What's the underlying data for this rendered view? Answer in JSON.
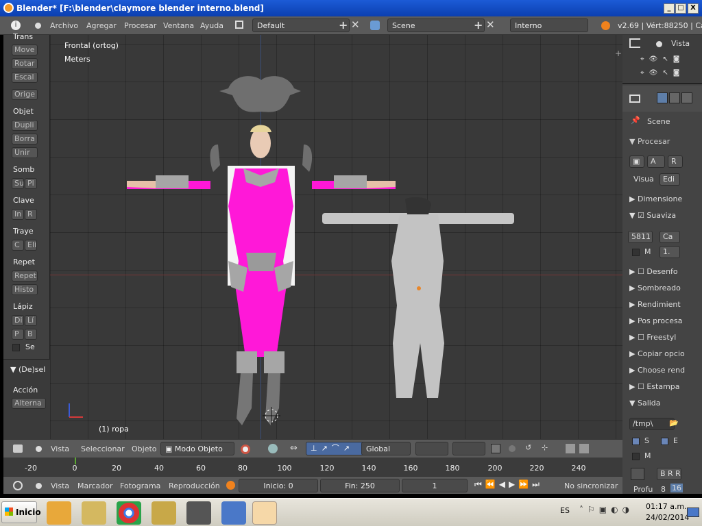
{
  "window": {
    "title": "Blender* [F:\\blender\\claymore blender interno.blend]",
    "min": "_",
    "max": "□",
    "close": "X"
  },
  "menu": {
    "items": [
      "Archivo",
      "Agregar",
      "Procesar",
      "Ventana",
      "Ayuda"
    ],
    "layout": "Default",
    "scene": "Scene",
    "engine": "Interno",
    "version": "v2.69 | Vért:88250 | Ca"
  },
  "viewport": {
    "view_name": "Frontal (ortog)",
    "units": "Meters",
    "object_label": "(1) ropa"
  },
  "toolshelf": {
    "sections": [
      {
        "title": "Trans",
        "buttons": [
          "Move",
          "Rotar",
          "Escal",
          "Orige"
        ]
      },
      {
        "title": "Objet",
        "buttons": [
          "Dupli",
          "Borra",
          "Unir"
        ]
      },
      {
        "title": "Somb",
        "buttons": [
          "Su",
          "Pl"
        ]
      },
      {
        "title": "Clave",
        "buttons": [
          "In",
          "R"
        ]
      },
      {
        "title": "Traye",
        "buttons": [
          "C",
          "Eli"
        ]
      },
      {
        "title": "Repet",
        "buttons": [
          "Repet",
          "Histo"
        ]
      },
      {
        "title": "Lápiz",
        "buttons": [
          "Di",
          "Lí",
          "P",
          "B"
        ]
      }
    ],
    "checkbox_label": "Se",
    "operator_panel": "(De)sel",
    "action_label": "Acción",
    "action_value": "Alterna"
  },
  "outliner": {
    "view_menu": "Vista"
  },
  "properties": {
    "context": "Scene",
    "render_panel": "Procesar",
    "render_btn_anim": "A",
    "render_btn_r": "R",
    "display_label": "Visua",
    "display_value": "Edi",
    "panels": [
      "Dimensione",
      "Suaviza",
      "Desenfo",
      "Sombreado",
      "Rendimient",
      "Pos procesa",
      "Freestyl",
      "Copiar opcio",
      "Choose rend",
      "Estampa",
      "Salida"
    ],
    "aa_samples": "5811",
    "aa_filter": "Ca",
    "aa_m": "M",
    "aa_value": "1.",
    "output_path": "/tmp\\",
    "out_s": "S",
    "out_e": "E",
    "out_m": "M",
    "out_brr": "B R R",
    "profu_label": "Profu",
    "profu_val1": "8",
    "profu_val2": "16"
  },
  "view_header": {
    "vista": "Vista",
    "seleccionar": "Seleccionar",
    "objeto": "Objeto",
    "mode": "Modo Objeto",
    "orientation": "Global"
  },
  "timeline": {
    "ticks": [
      "-20",
      "0",
      "20",
      "40",
      "60",
      "80",
      "100",
      "120",
      "140",
      "160",
      "180",
      "200",
      "220",
      "240"
    ]
  },
  "timeline_header": {
    "vista": "Vista",
    "marcador": "Marcador",
    "fotograma": "Fotograma",
    "reproduccion": "Reproducción",
    "start": "Inicio: 0",
    "end": "Fin: 250",
    "current": "1",
    "sync": "No sincronizar"
  },
  "taskbar": {
    "start": "Inicio",
    "lang": "ES",
    "time": "01:17 a.m.",
    "date": "24/02/2014"
  },
  "colors": {
    "suit_pink": "#ff18d8",
    "armor_gray": "#a6a6a6",
    "viewport_bg": "#393939",
    "titlebar": "#1c5bd6"
  }
}
